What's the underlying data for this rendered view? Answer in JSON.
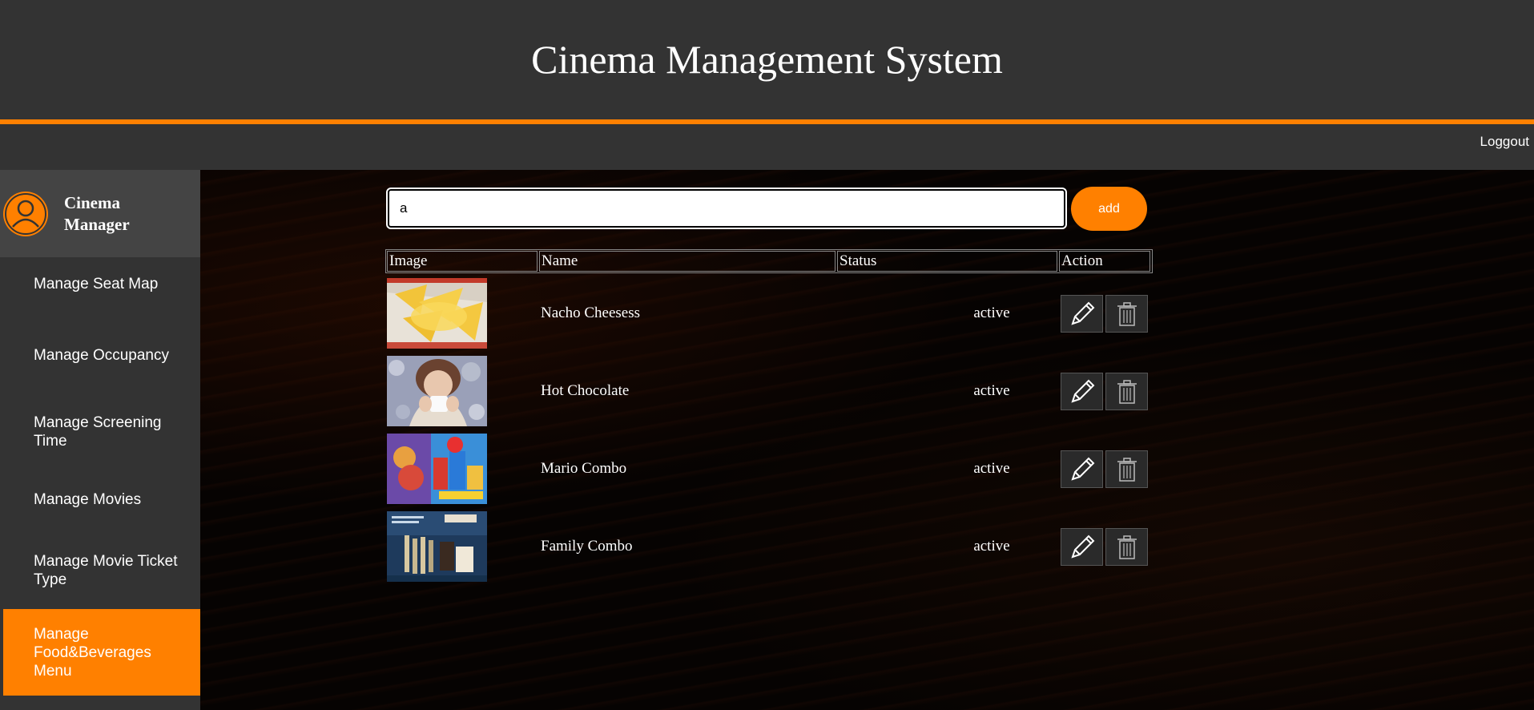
{
  "header": {
    "title": "Cinema Management System"
  },
  "topbar": {
    "logout_label": "Loggout"
  },
  "sidebar": {
    "profile_name": "Cinema Manager",
    "items": [
      {
        "label": "Manage Seat Map"
      },
      {
        "label": "Manage Occupancy"
      },
      {
        "label": "Manage Screening Time"
      },
      {
        "label": "Manage Movies"
      },
      {
        "label": "Manage Movie Ticket Type"
      },
      {
        "label": "Manage Food&Beverages Menu"
      }
    ],
    "active_item": "Manage Food&Beverages Menu"
  },
  "search": {
    "value": "a"
  },
  "toolbar": {
    "add_label": "add"
  },
  "table": {
    "headers": [
      "Image",
      "Name",
      "Status",
      "Action"
    ],
    "rows": [
      {
        "name": "Nacho Cheesess",
        "status": "active"
      },
      {
        "name": "Hot Chocolate",
        "status": "active"
      },
      {
        "name": "Mario Combo",
        "status": "active"
      },
      {
        "name": "Family Combo",
        "status": "active"
      }
    ]
  },
  "colors": {
    "accent": "#ff8000",
    "panel": "#333333",
    "background": "#000000"
  }
}
